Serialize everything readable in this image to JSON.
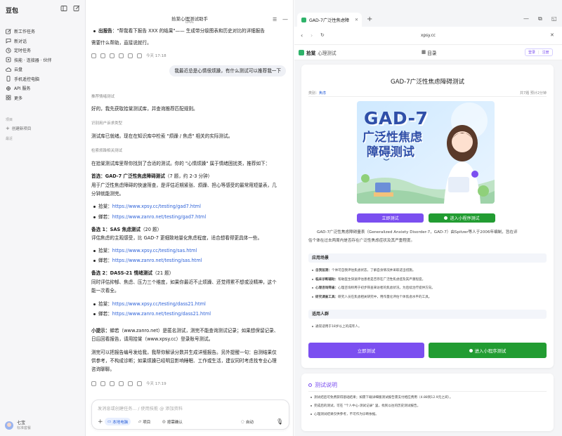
{
  "sidebar": {
    "brand": "豆包",
    "nav": [
      {
        "label": "新工作任务",
        "icon": "edit-icon"
      },
      {
        "label": "新对话",
        "icon": "chat-icon"
      },
      {
        "label": "定时任务",
        "icon": "clock-icon"
      },
      {
        "label": "技能 · 连接器 · 伙伴",
        "icon": "puzzle-icon"
      },
      {
        "label": "云盘",
        "icon": "cloud-icon"
      },
      {
        "label": "手机遥控电脑",
        "icon": "phone-icon"
      },
      {
        "label": "API 服务",
        "icon": "api-icon"
      },
      {
        "label": "更多",
        "icon": "grid-icon"
      }
    ],
    "projects_label": "项目",
    "new_project": "创建新项目",
    "recent_label": "最近",
    "user_name": "七宝",
    "user_plan": "标准套餐"
  },
  "chat": {
    "title": "拾棠心理测试助手",
    "subtitle": "DAVE",
    "top_line_bold": "出报告",
    "top_line": "：\"帮我看下报告 XXX 的结果\"—— 生成带分级图表和历史对比的详细报告",
    "need_help": "需要什么帮助，直接说就行。",
    "time1": "今天 17:18",
    "user_msg": "我最近总是心情很烦躁，有什么测试可以推荐我一下",
    "step1": "推荐情绪测试",
    "reply1": "好的，我先获取拾棠测试库，并查询推荐匹配规则。",
    "step2": "识别用户诉求类型",
    "reply2": "测试库已就绪。现在在知识库中检索 \"烦躁 / 焦虑\" 相关的实际测试。",
    "step3": "检索烦躁相关测试",
    "intro": "在拾棠测试库里帮你找到了合适的测试。你的 \"心情烦躁\" 属于情绪困扰类，推荐如下：",
    "rec1_title": "首选：GAD-7 广泛性焦虑障碍测试",
    "rec1_meta": "（7 题，约 2-3 分钟）",
    "rec1_desc": "用于广泛性焦虑障碍的快速筛查，是评估近期紧张、烦躁、担心等感受的最常用短量表，几",
    "rec1_desc2": "分钟就能测完。",
    "rec1_l1_label": "拾棠：",
    "rec1_l1": "https://www.xpsy.cc/testing/gad7.html",
    "rec1_l2_label": "蝉若：",
    "rec1_l2": "https://www.zanro.net/testing/gad7.html",
    "rec2_title": "备选 1：SAS 焦虑测试",
    "rec2_meta": "（20 题）",
    "rec2_desc": "评估焦虑的主观感受，比 GAD-7 更细致地量化焦虑程度，适合想看得更具体一些。",
    "rec2_l1": "https://www.xpsy.cc/testing/sas.html",
    "rec2_l2": "https://www.zanro.net/testing/sas.html",
    "rec3_title": "备选 2：DASS-21 情绪测试",
    "rec3_meta": "（21 题）",
    "rec3_desc": "同时评估抑郁、焦虑、压力三个维度，如果你最近不止烦躁、还觉得累不想或没精神，这个",
    "rec3_desc2": "能一次看全。",
    "rec3_l1": "https://www.xpsy.cc/testing/dass21.html",
    "rec3_l2": "https://www.zanro.net/testing/dass21.html",
    "tip_bold": "小提示：",
    "tip1": "蝉若（www.zanro.net）是匿名测试，测完不能查询测试记录；如果想保留记录、",
    "tip2": "日后回看报告，请用拾棠（www.xpsy.cc）登录账号测试。",
    "tip3": "测完可以把报告编号发给我，我帮你解读分数并生成详细报告。另外提醒一句：自测结果仅",
    "tip4": "供参考，不构成诊断；如果烦躁已经明显影响睡眠、工作或生活，建议同时考虑找专业心理",
    "tip5": "咨询聊聊。",
    "time2": "今天 17:19",
    "input_placeholder": "发消息或创建任务... / 使用技能 @ 添加资料",
    "chip_local": "本地电脑",
    "chip_project": "项目",
    "chip_confirm": "按需确认",
    "chip_auto": "自动"
  },
  "browser": {
    "tab_title": "GAD-7广泛性焦虑障",
    "url": "xpsy.cc",
    "site_name": "拾棠",
    "site_sub": "心理测试",
    "toc": "目录",
    "login": "登录",
    "register": "注册",
    "test_title": "GAD-7广泛性焦虑障碍测试",
    "category_label": "类别：",
    "category": "焦虑",
    "count": "共7题 预计2分钟",
    "cover_line1": "GAD-7",
    "cover_line2": "广泛性焦虑",
    "cover_line3": "障碍测试",
    "btn_start": "立即测试",
    "btn_mini": "进入小程序测试",
    "description": "GAD-7广泛性焦虑障碍量表（Generalized Anxiety Disorder-7，GAD-7）由Spitzer等人于2006年编制，旨在评",
    "description2": "估个体在过去两周内是否存在广泛性焦虑症状及其严重程度。",
    "scenario_head": "应用场景",
    "scenarios": [
      {
        "b": "自我监测：",
        "t": "个体可自我评估焦虑状态，了解自身情况并采取适当措施。"
      },
      {
        "b": "临床诊断辅助：",
        "t": "帮助医生快速评估患者是否存在广泛性焦虑症及其严重程度。"
      },
      {
        "b": "心理咨询筛查：",
        "t": "心理咨询师用于初步筛查来访者的焦虑状况，为后续治疗提供方向。"
      },
      {
        "b": "研究调查工具：",
        "t": "研究人员在焦虑相关研究中，用作量化评估个体焦虑水平的工具。"
      }
    ],
    "audience_head": "适用人群",
    "audience": "通常适用于18岁以上的成年人。",
    "note_head": "测试说明",
    "notes": [
      "测试结后可免费获得基础结果；如需下载详细版测试报告需支付相应费用（4.88到12.9元之间）。",
      "完成后的测试，可在 \"个人中心-测试记录\" 里，找到以往的历史测试报告。",
      "心理测试结果仅供参考，不可作为诊断依据。"
    ]
  },
  "colors": {
    "purple": "#7b4ff0",
    "green": "#229c32",
    "link": "#2f63d8"
  }
}
